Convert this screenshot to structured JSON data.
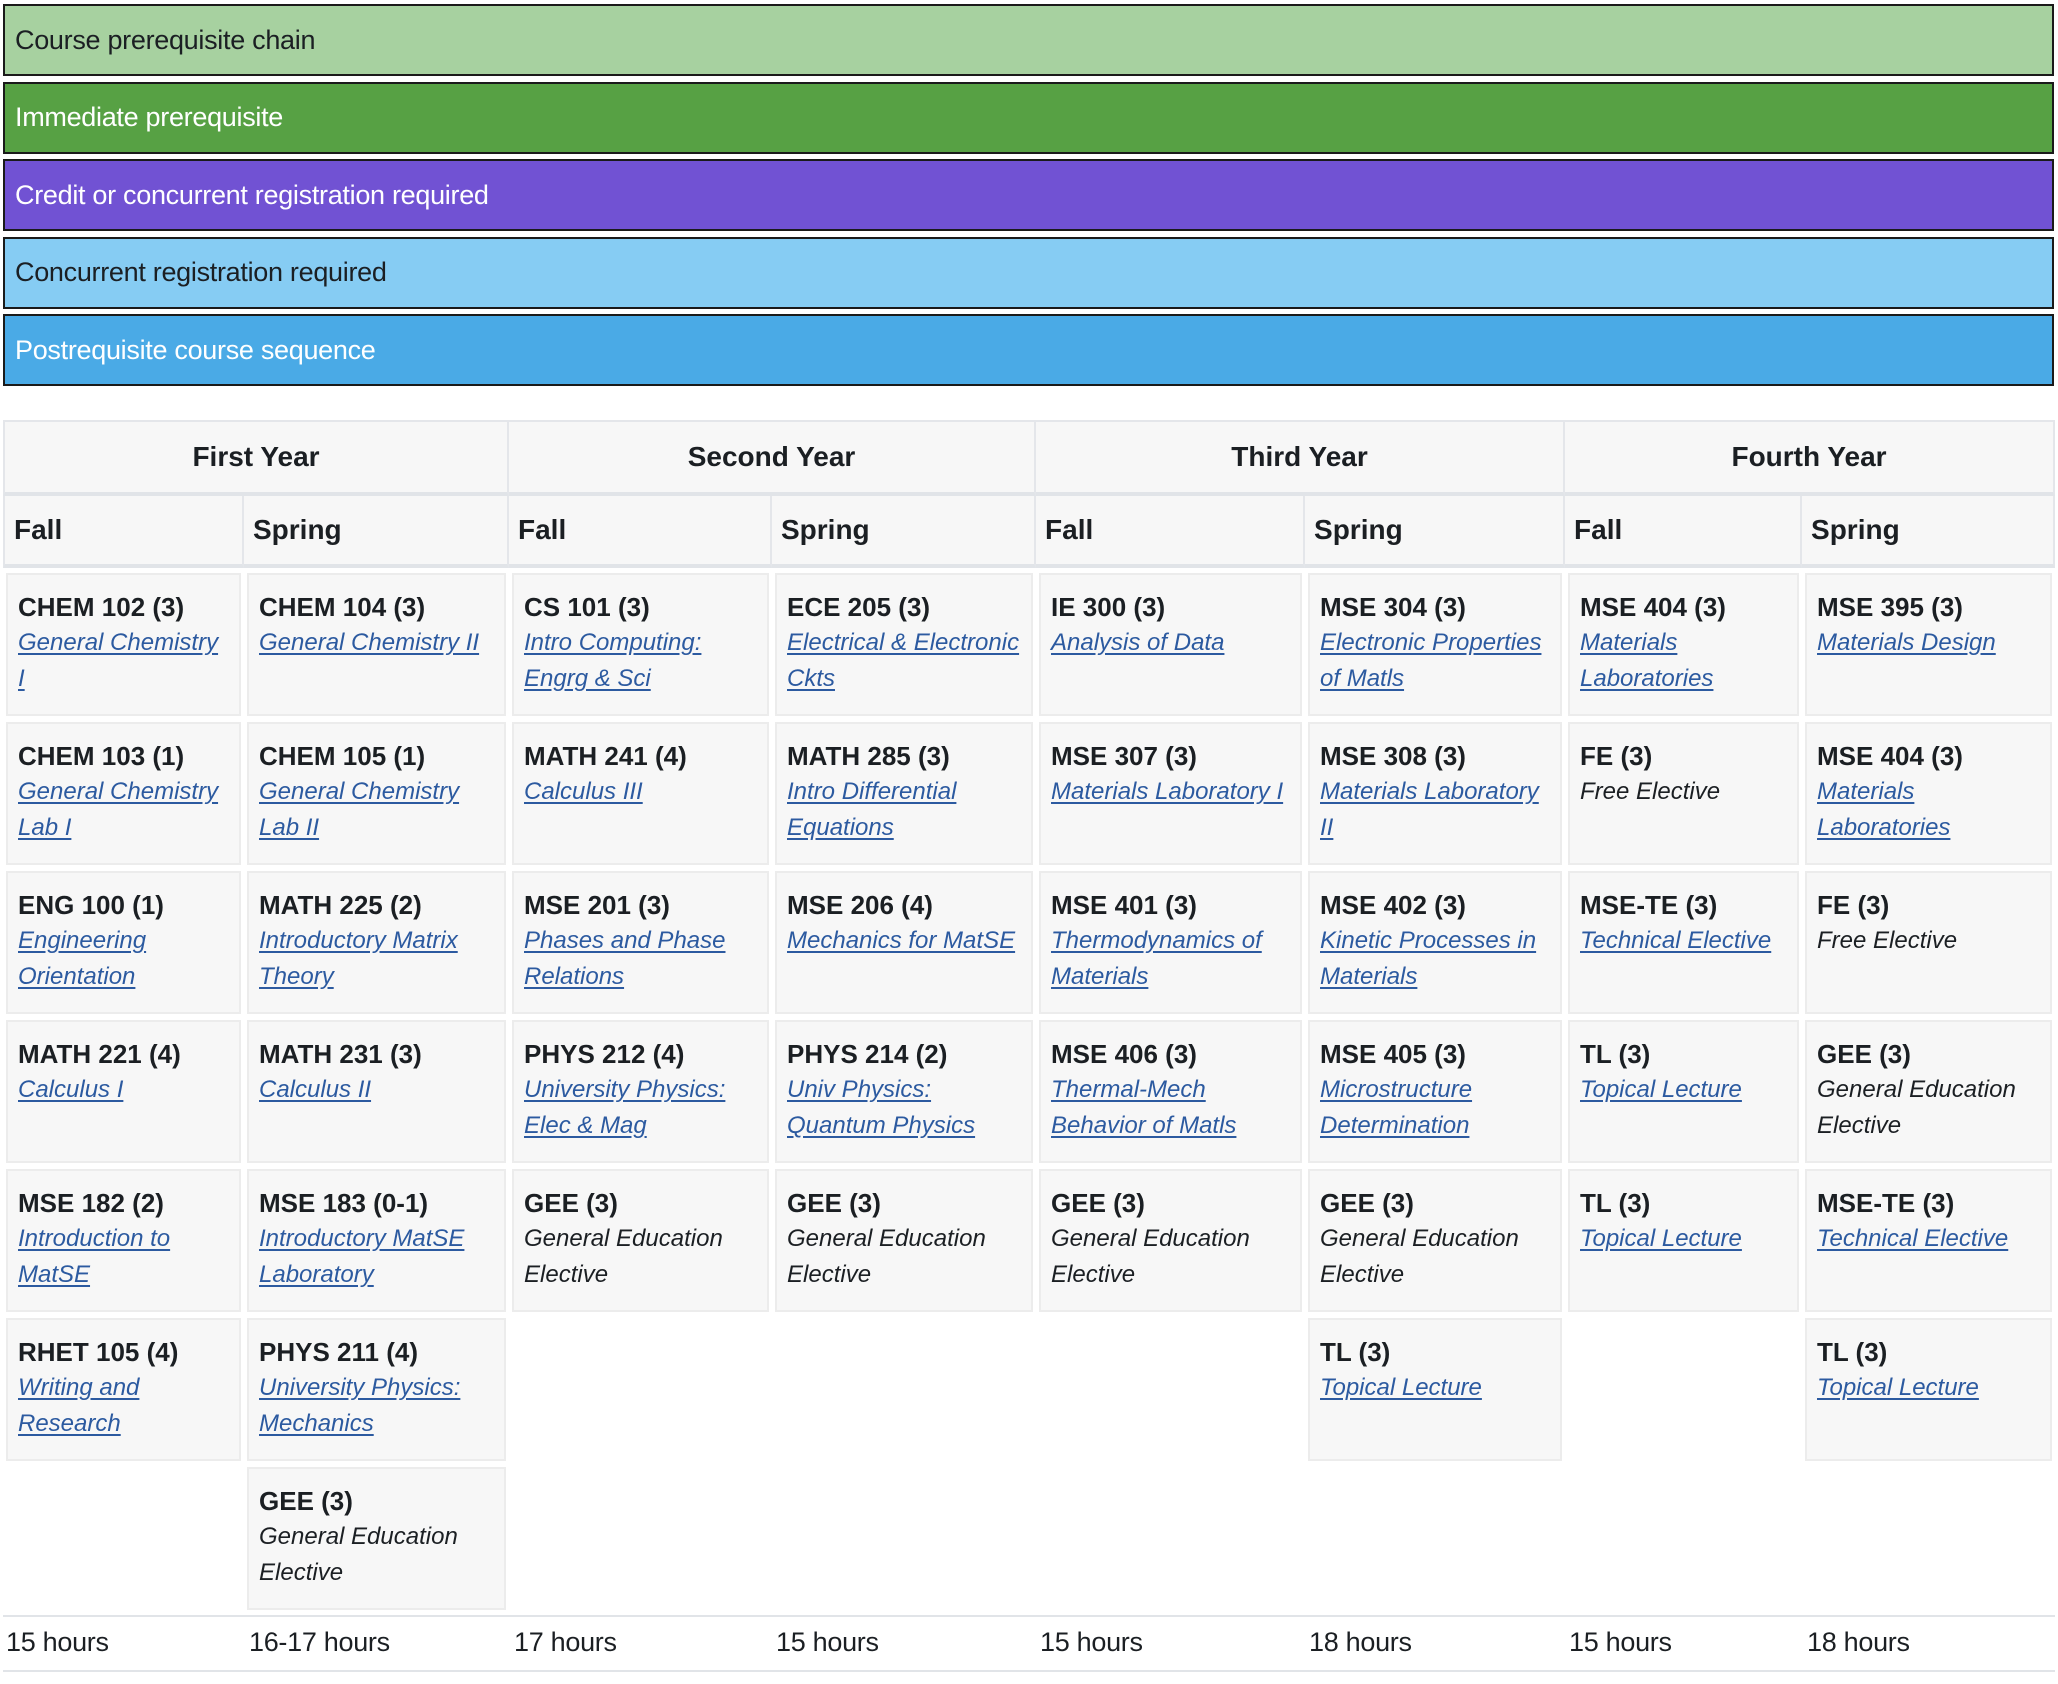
{
  "legend": [
    {
      "label": "Course prerequisite chain",
      "color": "#a7d1a0",
      "text_tone": "dark"
    },
    {
      "label": "Immediate prerequisite",
      "color": "#57a144",
      "text_tone": "light"
    },
    {
      "label": "Credit or concurrent registration required",
      "color": "#7152d3",
      "text_tone": "light"
    },
    {
      "label": "Concurrent registration required",
      "color": "#86ccf3",
      "text_tone": "dark"
    },
    {
      "label": "Postrequisite course sequence",
      "color": "#4aaae6",
      "text_tone": "light"
    }
  ],
  "years": [
    "First Year",
    "Second Year",
    "Third Year",
    "Fourth Year"
  ],
  "semesters": [
    "Fall",
    "Spring",
    "Fall",
    "Spring",
    "Fall",
    "Spring",
    "Fall",
    "Spring"
  ],
  "columns": [
    {
      "courses": [
        {
          "code": "CHEM 102 (3)",
          "title": "General Chemistry I",
          "link": true
        },
        {
          "code": "CHEM 103 (1)",
          "title": "General Chemistry Lab I",
          "link": true
        },
        {
          "code": "ENG 100 (1)",
          "title": "Engineering Orientation",
          "link": true
        },
        {
          "code": "MATH 221 (4)",
          "title": "Calculus I",
          "link": true
        },
        {
          "code": "MSE 182 (2)",
          "title": "Introduction to MatSE",
          "link": true
        },
        {
          "code": "RHET 105 (4)",
          "title": "Writing and Research",
          "link": true
        }
      ]
    },
    {
      "courses": [
        {
          "code": "CHEM 104 (3)",
          "title": "General Chemistry II",
          "link": true
        },
        {
          "code": "CHEM 105 (1)",
          "title": "General Chemistry Lab II",
          "link": true
        },
        {
          "code": "MATH 225 (2)",
          "title": "Introductory Matrix Theory",
          "link": true
        },
        {
          "code": "MATH 231 (3)",
          "title": "Calculus II",
          "link": true
        },
        {
          "code": "MSE 183 (0-1)",
          "title": "Introductory MatSE Laboratory",
          "link": true
        },
        {
          "code": "PHYS 211 (4)",
          "title": "University Physics: Mechanics",
          "link": true
        },
        {
          "code": "GEE (3)",
          "title": "General Education Elective",
          "link": false
        }
      ]
    },
    {
      "courses": [
        {
          "code": "CS 101 (3)",
          "title": "Intro Computing: Engrg & Sci",
          "link": true
        },
        {
          "code": "MATH 241 (4)",
          "title": "Calculus III",
          "link": true
        },
        {
          "code": "MSE 201 (3)",
          "title": "Phases and Phase Relations",
          "link": true
        },
        {
          "code": "PHYS 212 (4)",
          "title": "University Physics: Elec & Mag",
          "link": true
        },
        {
          "code": "GEE (3)",
          "title": "General Education Elective",
          "link": false
        }
      ]
    },
    {
      "courses": [
        {
          "code": "ECE 205 (3)",
          "title": "Electrical & Electronic Ckts",
          "link": true
        },
        {
          "code": "MATH 285 (3)",
          "title": "Intro Differential Equations",
          "link": true
        },
        {
          "code": "MSE 206 (4)",
          "title": "Mechanics for MatSE",
          "link": true
        },
        {
          "code": "PHYS 214 (2)",
          "title": "Univ Physics: Quantum Physics",
          "link": true
        },
        {
          "code": "GEE (3)",
          "title": "General Education Elective",
          "link": false
        }
      ]
    },
    {
      "courses": [
        {
          "code": "IE 300 (3)",
          "title": "Analysis of Data",
          "link": true
        },
        {
          "code": "MSE 307 (3)",
          "title": "Materials Laboratory I",
          "link": true
        },
        {
          "code": "MSE 401 (3)",
          "title": "Thermodynamics of Materials",
          "link": true
        },
        {
          "code": "MSE 406 (3)",
          "title": "Thermal-Mech Behavior of Matls",
          "link": true
        },
        {
          "code": "GEE (3)",
          "title": "General Education Elective",
          "link": false
        }
      ]
    },
    {
      "courses": [
        {
          "code": "MSE 304 (3)",
          "title": "Electronic Properties of Matls",
          "link": true
        },
        {
          "code": "MSE 308 (3)",
          "title": "Materials Laboratory II",
          "link": true
        },
        {
          "code": "MSE 402 (3)",
          "title": "Kinetic Processes in Materials",
          "link": true
        },
        {
          "code": "MSE 405 (3)",
          "title": "Microstructure Determination",
          "link": true
        },
        {
          "code": "GEE (3)",
          "title": "General Education Elective",
          "link": false
        },
        {
          "code": "TL (3)",
          "title": "Topical Lecture",
          "link": true
        }
      ]
    },
    {
      "courses": [
        {
          "code": "MSE 404 (3)",
          "title": "Materials Laboratories",
          "link": true
        },
        {
          "code": "FE (3)",
          "title": "Free Elective",
          "link": false
        },
        {
          "code": "MSE-TE (3)",
          "title": "Technical Elective",
          "link": true
        },
        {
          "code": "TL (3)",
          "title": "Topical Lecture",
          "link": true
        },
        {
          "code": "TL (3)",
          "title": "Topical Lecture",
          "link": true
        }
      ]
    },
    {
      "courses": [
        {
          "code": "MSE 395 (3)",
          "title": "Materials Design",
          "link": true
        },
        {
          "code": "MSE 404 (3)",
          "title": "Materials Laboratories",
          "link": true
        },
        {
          "code": "FE (3)",
          "title": "Free Elective",
          "link": false
        },
        {
          "code": "GEE (3)",
          "title": "General Education Elective",
          "link": false
        },
        {
          "code": "MSE-TE (3)",
          "title": "Technical Elective",
          "link": true
        },
        {
          "code": "TL (3)",
          "title": "Topical Lecture",
          "link": true
        }
      ]
    }
  ],
  "hours": [
    "15 hours",
    "16-17 hours",
    "17 hours",
    "15 hours",
    "15 hours",
    "18 hours",
    "15 hours",
    "18 hours"
  ]
}
